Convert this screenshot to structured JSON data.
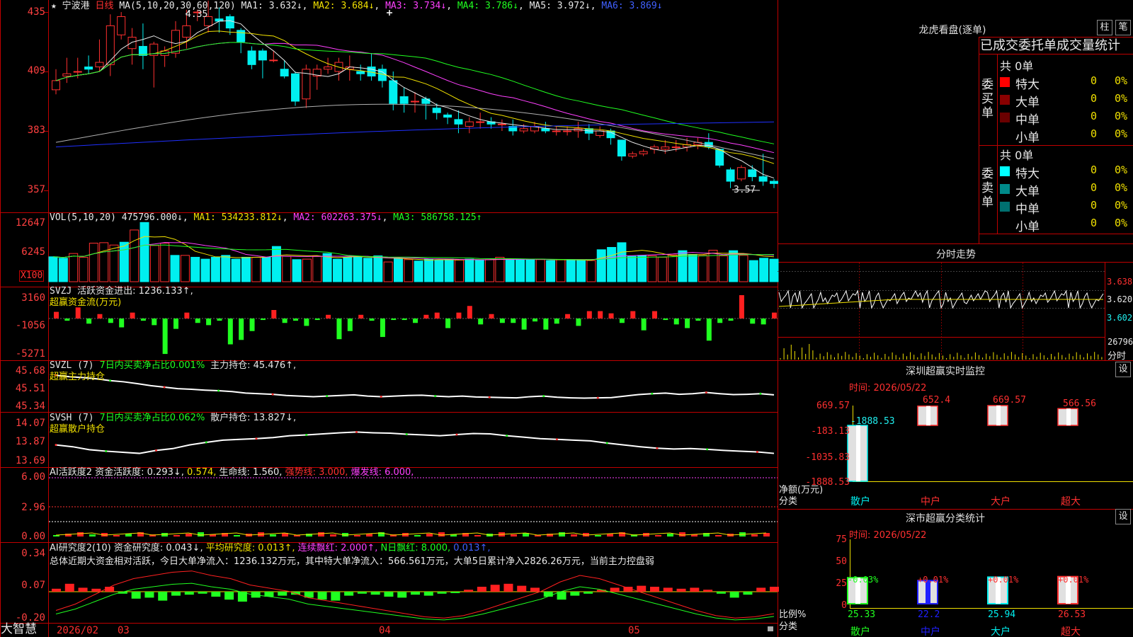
{
  "header": {
    "star": "★",
    "stock_name": "宁波港",
    "period": "日线",
    "ma_label": "MA(5,10,20,30,60,120)",
    "ma_values": [
      {
        "name": "MA1",
        "value": "3.632↓",
        "color": "#e8e8e8"
      },
      {
        "name": "MA2",
        "value": "3.684↓",
        "color": "#f0e000"
      },
      {
        "name": "MA3",
        "value": "3.734↓",
        "color": "#ff40ff"
      },
      {
        "name": "MA4",
        "value": "3.786↓",
        "color": "#20ff20"
      },
      {
        "name": "MA5",
        "value": "3.972↓",
        "color": "#e8e8e8"
      },
      {
        "name": "MA6",
        "value": "3.869↓",
        "color": "#4060ff"
      }
    ],
    "ma1_prefix": "MA1: ",
    "ma2_prefix": "MA2: ",
    "ma3_prefix": "MA3: ",
    "ma4_prefix": "MA4: ",
    "ma5_prefix": "MA5: ",
    "ma6_prefix": "MA6: "
  },
  "price_axis": [
    "435",
    "409",
    "383",
    "357"
  ],
  "annotations": {
    "high": "4.35",
    "low": "3.57"
  },
  "vol": {
    "label": "VOL(5,10,20)",
    "value": "475796.000↓",
    "ma1": "MA1: 534233.812↓",
    "ma2": "MA2: 602263.375↓",
    "ma3": "MA3: 586758.125↑",
    "axis": [
      "12647",
      "6245"
    ],
    "unit": "X100"
  },
  "svzj": {
    "label": "SVZJ",
    "title": "活跃资金进出: 1236.133↑,",
    "subtitle": "超赢资金流(万元)",
    "axis": [
      "3160",
      "-1056",
      "-5271"
    ]
  },
  "svzl": {
    "label": "SVZL (7)",
    "desc": "7日内买卖净占比0.001%",
    "value": "主力持仓: 45.476↑,",
    "subtitle": "超赢主力持仓",
    "axis": [
      "45.68",
      "45.51",
      "45.34"
    ]
  },
  "svsh": {
    "label": "SVSH (7)",
    "desc": "7日内买卖净占比0.062%",
    "value": "散户持仓: 13.827↓,",
    "subtitle": "超赢散户持仓",
    "axis": [
      "14.07",
      "13.87",
      "13.69"
    ]
  },
  "ai1": {
    "label": "AI活跃度2",
    "a": "资金活跃度: 0.293↓,",
    "b": "0.574,",
    "c": "生命线: 1.560,",
    "d": "强势线: 3.000,",
    "e": "爆发线: 6.000,",
    "axis": [
      "6.00",
      "2.96",
      "0.00"
    ]
  },
  "ai2": {
    "label": "AI研究度2(10)",
    "a": "资金研究度: 0.043↓,",
    "b": "平均研究度: 0.013↑,",
    "c": "连续飘红: 2.000↑,",
    "d": "N日飘红: 8.000,",
    "e": "0.013↑,",
    "note": "总体近期大资金相对活跃，今日大单净流入：1236.132万元，其中特大单净流入：566.561万元，大单5日累计净入2826.26万元，当前主力控盘弱",
    "axis": [
      "0.34",
      "0.07",
      "-0.20"
    ]
  },
  "footer": {
    "brand": "大智慧",
    "dates": [
      "2026/02",
      "03",
      "04",
      "05"
    ]
  },
  "lhkp": {
    "title": "龙虎看盘(逐单)",
    "btn1": "柱",
    "btn2": "笔",
    "subtitle": "已成交委托单成交量统计",
    "buy_side": "委买单",
    "sell_side": "委卖单",
    "buy": {
      "total": "共 0单",
      "rows": [
        {
          "label": "特大",
          "count": "0",
          "pct": "0%",
          "color": "#ff0000"
        },
        {
          "label": "大单",
          "count": "0",
          "pct": "0%",
          "color": "#8a0000"
        },
        {
          "label": "中单",
          "count": "0",
          "pct": "0%",
          "color": "#6a0000"
        },
        {
          "label": "小单",
          "count": "0",
          "pct": "0%",
          "color": "#000000"
        }
      ]
    },
    "sell": {
      "total": "共 0单",
      "rows": [
        {
          "label": "特大",
          "count": "0",
          "pct": "0%",
          "color": "#00ffff"
        },
        {
          "label": "大单",
          "count": "0",
          "pct": "0%",
          "color": "#008a8a"
        },
        {
          "label": "中单",
          "count": "0",
          "pct": "0%",
          "color": "#007070"
        },
        {
          "label": "小单",
          "count": "0",
          "pct": "0%",
          "color": "#000000"
        }
      ]
    }
  },
  "fenshi": {
    "title": "分时走势",
    "axis": [
      "3.638",
      "3.620",
      "3.602"
    ],
    "vol_axis": "26796",
    "vol_unit": "分时"
  },
  "sz_monitor": {
    "title": "深圳超赢实时监控",
    "btn": "设",
    "time": "时间: 2026/05/22",
    "ylabel": "净额(万元)",
    "xlabel": "分类",
    "axis": [
      "669.57",
      "-183.13",
      "-1035.83",
      "-1888.53"
    ]
  },
  "sz_stats": {
    "title": "深市超赢分类统计",
    "btn": "设",
    "time": "时间: 2026/05/22",
    "ylabel": "比例%",
    "xlabel": "分类",
    "axis": [
      "75",
      "50",
      "25",
      "0"
    ]
  },
  "chart_data": [
    {
      "type": "candlestick",
      "title": "宁波港 日线",
      "y_ticks": [
        4.35,
        4.09,
        3.83,
        3.57
      ],
      "candles": [
        [
          4.01,
          4.05,
          3.99,
          4.1
        ],
        [
          4.07,
          4.08,
          4.04,
          4.15
        ],
        [
          4.09,
          4.09,
          4.06,
          4.15
        ],
        [
          4.11,
          4.1,
          4.08,
          4.16
        ],
        [
          4.11,
          4.13,
          4.09,
          4.23
        ],
        [
          4.12,
          4.29,
          4.07,
          4.34
        ],
        [
          4.25,
          4.33,
          4.23,
          4.35
        ],
        [
          4.19,
          4.24,
          4.12,
          4.28
        ],
        [
          4.2,
          4.16,
          4.1,
          4.3
        ],
        [
          4.16,
          4.21,
          4.02,
          4.22
        ],
        [
          4.16,
          4.18,
          4.11,
          4.2
        ],
        [
          4.17,
          4.27,
          4.15,
          4.31
        ],
        [
          4.24,
          4.29,
          4.19,
          4.36
        ],
        [
          4.35,
          4.35,
          4.31,
          4.36
        ],
        [
          4.29,
          4.33,
          4.26,
          4.4
        ],
        [
          4.32,
          4.31,
          4.26,
          4.37
        ],
        [
          4.33,
          4.28,
          4.25,
          4.34
        ],
        [
          4.27,
          4.22,
          4.17,
          4.28
        ],
        [
          4.18,
          4.12,
          4.1,
          4.2
        ],
        [
          4.18,
          4.14,
          4.06,
          4.19
        ],
        [
          4.14,
          4.14,
          4.13,
          4.18
        ],
        [
          4.1,
          4.07,
          4.06,
          4.14
        ],
        [
          4.08,
          3.96,
          3.94,
          4.09
        ],
        [
          3.97,
          4.1,
          3.93,
          4.12
        ],
        [
          4.07,
          4.1,
          4.01,
          4.12
        ],
        [
          4.1,
          4.11,
          4.08,
          4.15
        ],
        [
          4.09,
          4.13,
          4.05,
          4.15
        ],
        [
          4.1,
          4.11,
          4.05,
          4.16
        ],
        [
          4.09,
          4.08,
          4.05,
          4.12
        ],
        [
          4.11,
          4.07,
          4.05,
          4.17
        ],
        [
          4.1,
          4.05,
          4.02,
          4.12
        ],
        [
          4.05,
          3.95,
          3.92,
          4.09
        ],
        [
          3.98,
          3.95,
          3.91,
          4.02
        ],
        [
          3.96,
          3.96,
          3.91,
          4.0
        ],
        [
          3.97,
          3.95,
          3.88,
          3.98
        ],
        [
          3.93,
          3.91,
          3.88,
          3.95
        ],
        [
          3.9,
          3.89,
          3.86,
          3.91
        ],
        [
          3.88,
          3.86,
          3.82,
          3.92
        ],
        [
          3.85,
          3.87,
          3.82,
          3.89
        ],
        [
          3.87,
          3.87,
          3.84,
          3.91
        ],
        [
          3.87,
          3.86,
          3.84,
          3.89
        ],
        [
          3.86,
          3.86,
          3.83,
          3.88
        ],
        [
          3.85,
          3.83,
          3.81,
          3.88
        ],
        [
          3.83,
          3.84,
          3.82,
          3.86
        ],
        [
          3.83,
          3.85,
          3.82,
          3.87
        ],
        [
          3.84,
          3.83,
          3.82,
          3.87
        ],
        [
          3.83,
          3.83,
          3.81,
          3.85
        ],
        [
          3.83,
          3.83,
          3.81,
          3.85
        ],
        [
          3.83,
          3.84,
          3.8,
          3.87
        ],
        [
          3.84,
          3.82,
          3.79,
          3.86
        ],
        [
          3.81,
          3.83,
          3.8,
          3.85
        ],
        [
          3.83,
          3.8,
          3.77,
          3.84
        ],
        [
          3.79,
          3.72,
          3.7,
          3.79
        ],
        [
          3.72,
          3.73,
          3.71,
          3.74
        ],
        [
          3.73,
          3.74,
          3.72,
          3.75
        ],
        [
          3.75,
          3.76,
          3.73,
          3.77
        ],
        [
          3.75,
          3.76,
          3.73,
          3.79
        ],
        [
          3.76,
          3.76,
          3.74,
          3.79
        ],
        [
          3.76,
          3.77,
          3.74,
          3.8
        ],
        [
          3.77,
          3.78,
          3.75,
          3.8
        ],
        [
          3.78,
          3.76,
          3.75,
          3.82
        ],
        [
          3.75,
          3.68,
          3.67,
          3.75
        ],
        [
          3.66,
          3.61,
          3.58,
          3.67
        ],
        [
          3.62,
          3.67,
          3.61,
          3.68
        ],
        [
          3.66,
          3.63,
          3.61,
          3.68
        ],
        [
          3.63,
          3.61,
          3.59,
          3.73
        ],
        [
          3.61,
          3.6,
          3.58,
          3.62
        ]
      ],
      "annotations": {
        "high": 4.35,
        "low": 3.57
      }
    },
    {
      "type": "bar",
      "title": "VOL(5,10,20)",
      "y_ticks": [
        12647,
        6245
      ],
      "unit": "X100",
      "values": [
        5300,
        5000,
        6000,
        5200,
        8200,
        8300,
        7800,
        8400,
        11000,
        12600,
        7700,
        8200,
        5600,
        5600,
        5200,
        4800,
        5200,
        5600,
        4800,
        5200,
        5200,
        5200,
        7500,
        5400,
        4700,
        4800,
        5400,
        6000,
        4800,
        5200,
        5300,
        5000,
        5500,
        4200,
        4900,
        4700,
        4400,
        4800,
        4600,
        4800,
        4600,
        4800,
        4600,
        4700,
        5200,
        4800,
        4600,
        4800,
        4700,
        4500,
        4700,
        4600,
        4600,
        4500,
        6800,
        7300,
        8300,
        5400,
        5600,
        5500,
        5200,
        5700,
        6600,
        5800,
        5600,
        6700,
        5500,
        6600,
        5600,
        4500,
        5000,
        4800
      ],
      "up": [
        false,
        false,
        true,
        true,
        true,
        true,
        true,
        false,
        true,
        false,
        true,
        true,
        false,
        true,
        false,
        false,
        false,
        false,
        false,
        false,
        true,
        false,
        false,
        true,
        false,
        true,
        true,
        false,
        false,
        false,
        false,
        false,
        false,
        true,
        false,
        true,
        false,
        false,
        false,
        false,
        true,
        false,
        false,
        true,
        true,
        false,
        false,
        false,
        true,
        false,
        true,
        false,
        false,
        true,
        false,
        false,
        false,
        false,
        false,
        true,
        true,
        true,
        false,
        false,
        true,
        true,
        true,
        false,
        true,
        false,
        false,
        false
      ]
    },
    {
      "type": "bar",
      "title": "超赢资金流(万元)",
      "y_ticks": [
        3160,
        -1056,
        -5271
      ],
      "values": [
        900,
        -300,
        1500,
        -700,
        600,
        -600,
        -1200,
        800,
        -300,
        -900,
        -4800,
        -1400,
        800,
        -600,
        -900,
        -300,
        -3500,
        -2900,
        -1700,
        -200,
        1150,
        -600,
        -300,
        -1000,
        -200,
        500,
        -2800,
        -1700,
        500,
        -300,
        -2500,
        -200,
        -200,
        -600,
        500,
        800,
        -1300,
        800,
        1700,
        -800,
        600,
        -600,
        -600,
        -1500,
        -400,
        -1500,
        -700,
        600,
        -1000,
        1000,
        1000,
        700,
        -600,
        1000,
        -1600,
        1000,
        -200,
        -800,
        -1300,
        -300,
        -3000,
        -600,
        -300,
        3160,
        -700,
        -800,
        800
      ]
    },
    {
      "type": "line",
      "title": "超赢主力持仓",
      "y_ticks": [
        45.68,
        45.51,
        45.34
      ]
    },
    {
      "type": "line",
      "title": "超赢散户持仓",
      "y_ticks": [
        14.07,
        13.87,
        13.69
      ]
    },
    {
      "type": "bar",
      "title": "AI活跃度2",
      "y_ticks": [
        6.0,
        2.96,
        0.0
      ],
      "levels": {
        "生命线": 1.56,
        "强势线": 3.0,
        "爆发线": 6.0
      }
    },
    {
      "type": "bar",
      "title": "AI研究度2(10)",
      "y_ticks": [
        0.34,
        0.07,
        -0.2
      ]
    },
    {
      "type": "bar",
      "title": "深圳超赢实时监控",
      "categories": [
        "散户",
        "中户",
        "大户",
        "超大"
      ],
      "values": [
        -1888.53,
        652.4,
        669.57,
        566.56
      ],
      "y_ticks": [
        669.57,
        -183.13,
        -1035.83,
        -1888.53
      ],
      "xlabel": "分类",
      "ylabel": "净额(万元)"
    },
    {
      "type": "bar",
      "title": "深市超赢分类统计",
      "categories": [
        "散户",
        "中户",
        "大户",
        "超大"
      ],
      "values": [
        25.33,
        22.2,
        25.94,
        26.53
      ],
      "labels": [
        "-0.03%",
        "+0.01%",
        "+0.01%",
        "+0.01%"
      ],
      "y_ticks": [
        75,
        50,
        25,
        0
      ],
      "xlabel": "分类",
      "ylabel": "比例%"
    }
  ]
}
